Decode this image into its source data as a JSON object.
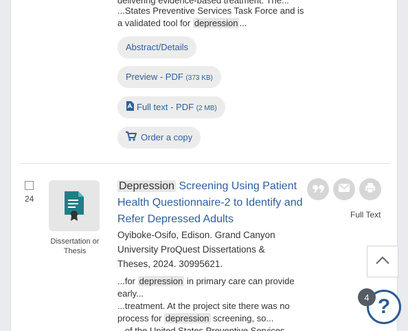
{
  "prev_result": {
    "snippet_line_0": "delivering evidence-based treatment. The...",
    "snippet_line_1": "...States Preventive Services Task Force and is",
    "snippet_line_2_pre": "a validated tool for ",
    "snippet_line_2_hl": "depression",
    "snippet_line_2_post": "...",
    "abstract_label": "Abstract/Details",
    "preview_label": "Preview - PDF",
    "preview_size": "(373 KB)",
    "fulltext_label": "Full text - PDF",
    "fulltext_size": "(2 MB)",
    "order_label": "Order a copy"
  },
  "result": {
    "number": "24",
    "doc_type": "Dissertation or Thesis",
    "title_hl": "Depression",
    "title_rest": " Screening Using Patient Health Questionnaire-2 to Identify and Refer Depressed Adults",
    "meta": "Oyiboke-Osifo, Edison.   Grand Canyon University ProQuest Dissertations & Theses,  2024. 30995621.",
    "snippet_1_pre": "...for ",
    "snippet_1_hl": "depression",
    "snippet_1_post": " in primary care can provide",
    "snippet_2": "early...",
    "snippet_3": "...treatment. At the project site there was no",
    "snippet_4_pre": "process for ",
    "snippet_4_hl": "depression",
    "snippet_4_post": " screening, so...",
    "snippet_5": "...of the United States Preventive Services",
    "fulltext_text": "Full Text"
  },
  "help": {
    "badge_count": "4",
    "symbol": "?"
  },
  "colors": {
    "link": "#2f5f9c",
    "highlight": "#e6e6e6",
    "help": "#2a5b94"
  }
}
